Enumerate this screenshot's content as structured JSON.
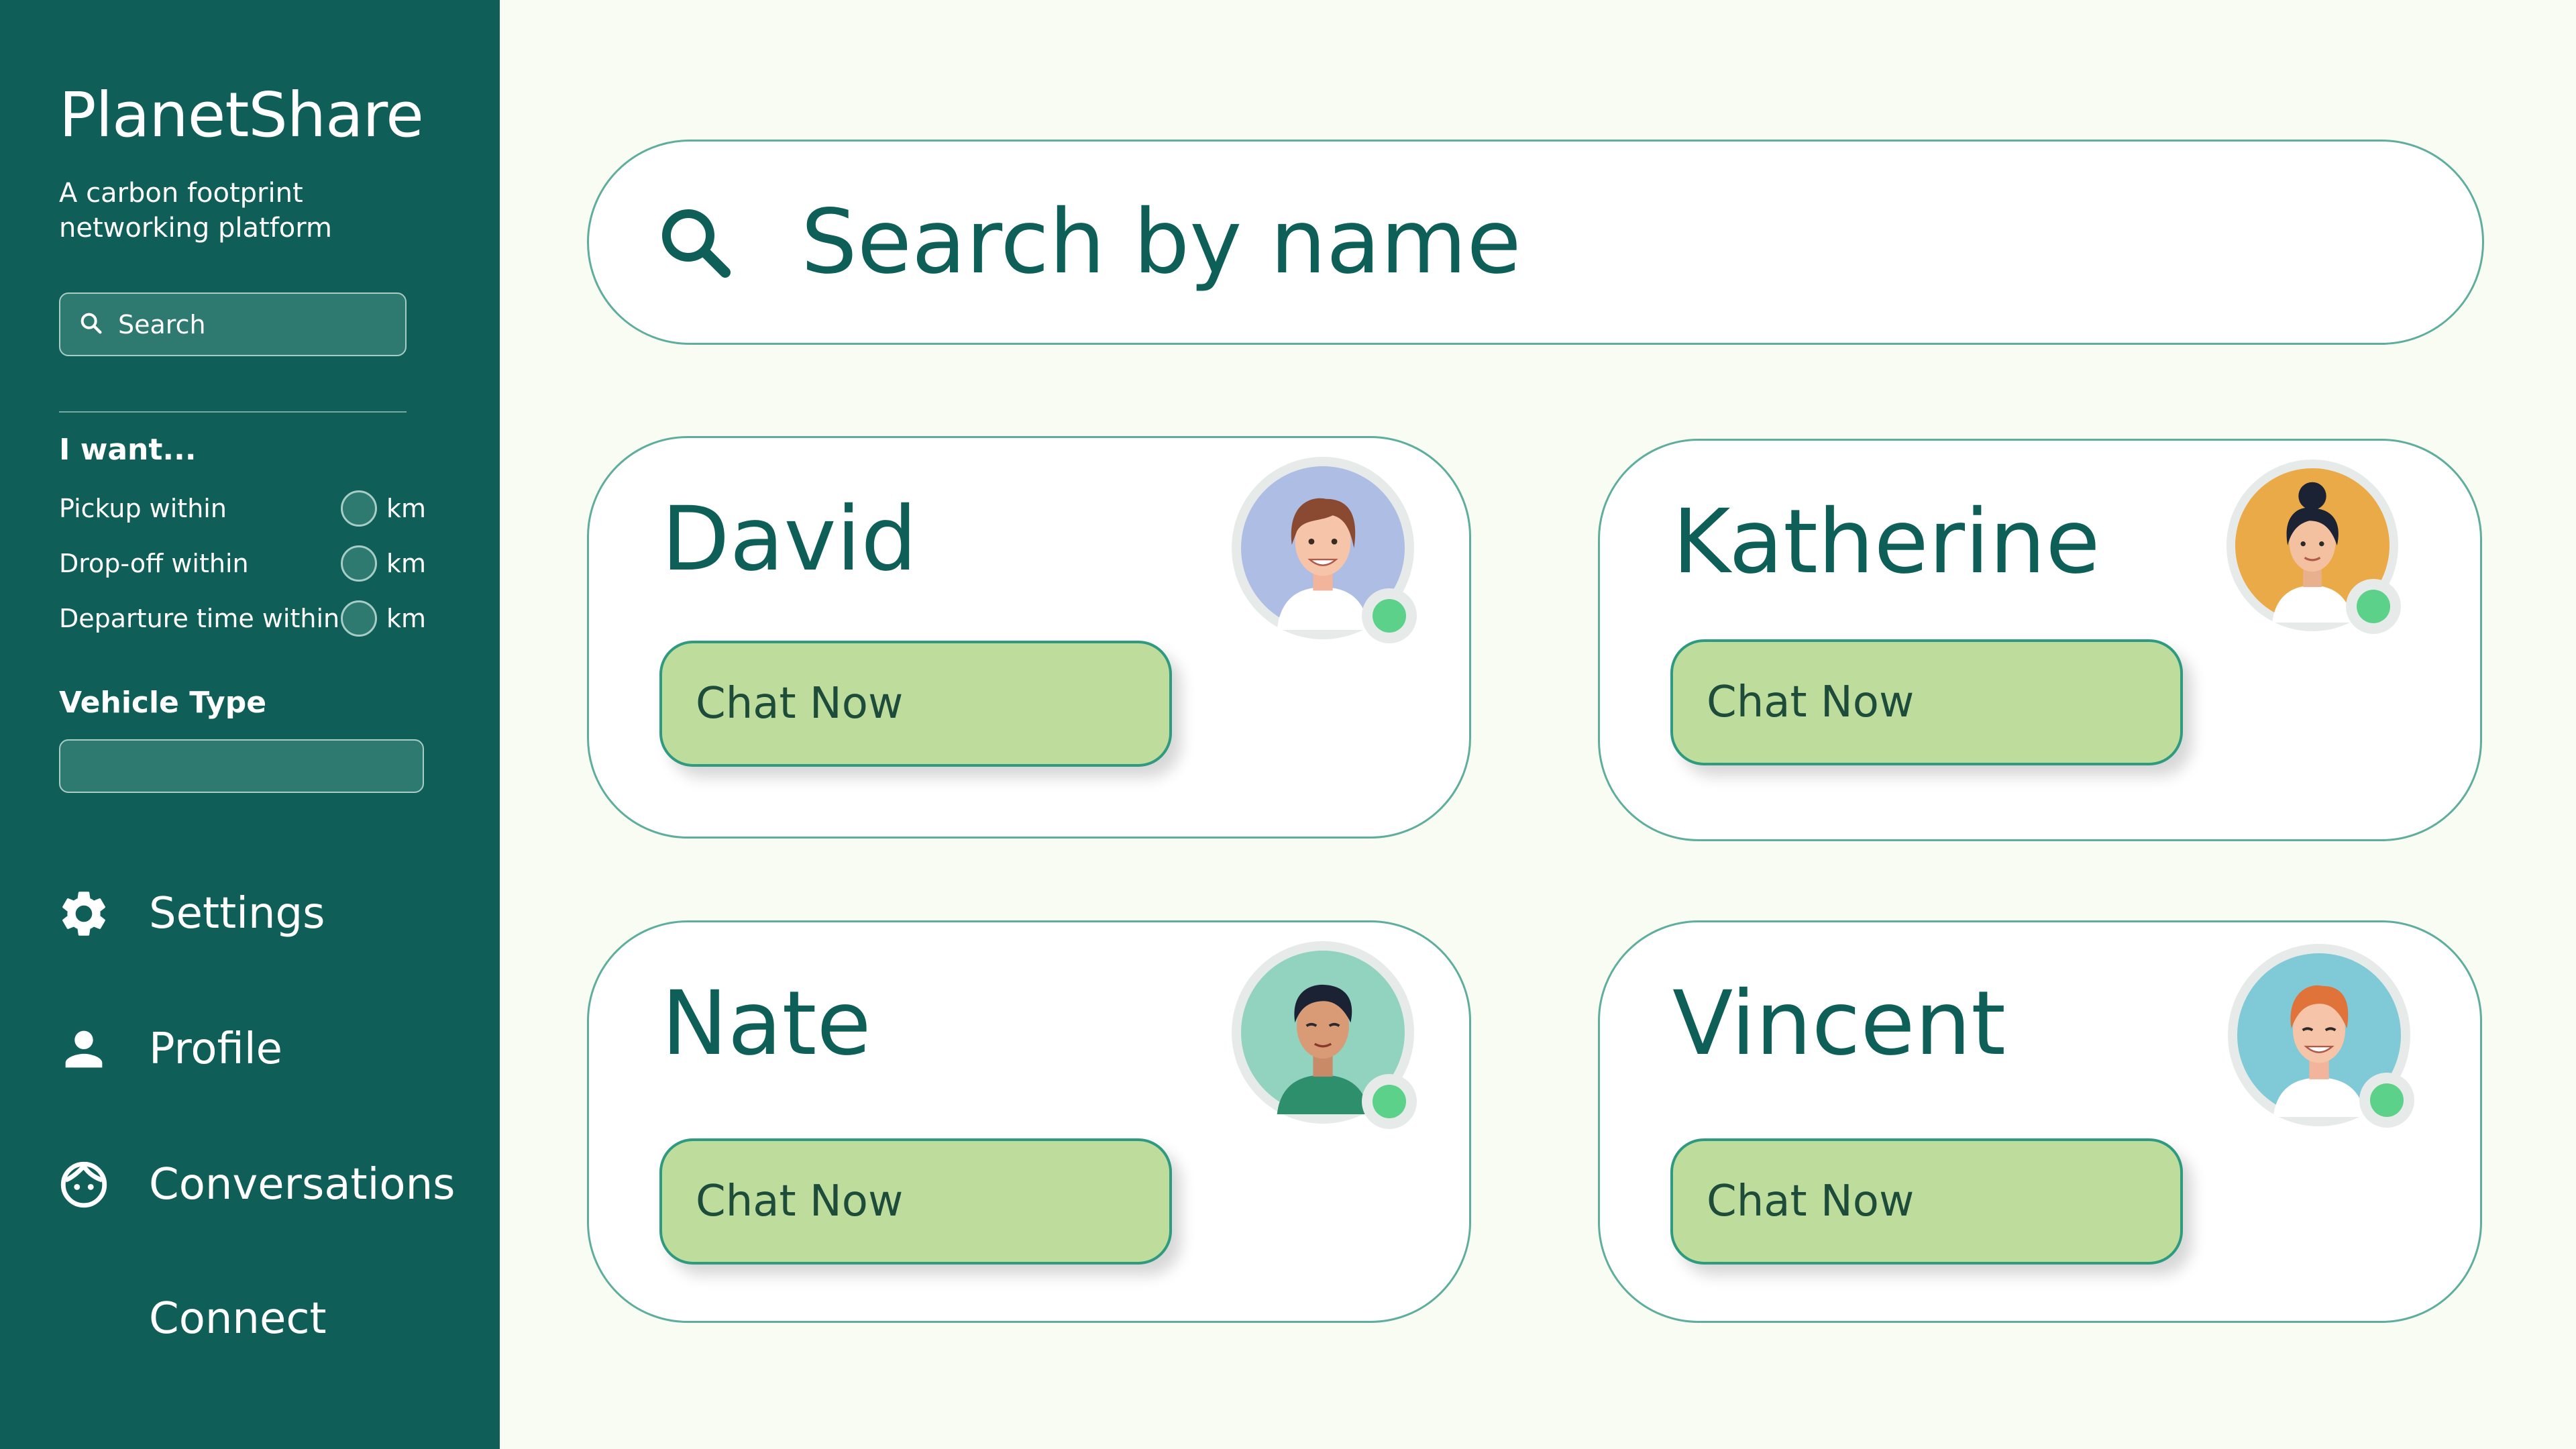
{
  "app": {
    "title": "PlanetShare",
    "subtitle": "A carbon footprint networking platform"
  },
  "sidebar": {
    "search_label": "Search",
    "want_heading": "I want...",
    "filters": [
      {
        "label": "Pickup within",
        "unit": "km"
      },
      {
        "label": "Drop-off within",
        "unit": "km"
      },
      {
        "label": "Departure time within",
        "unit": "km"
      }
    ],
    "vehicle_heading": "Vehicle Type",
    "vehicle_value": "",
    "nav": [
      {
        "label": "Settings",
        "icon": "gear-icon"
      },
      {
        "label": "Profile",
        "icon": "person-icon"
      },
      {
        "label": "Conversations",
        "icon": "face-icon"
      },
      {
        "label": "Connect",
        "icon": ""
      }
    ]
  },
  "main": {
    "search_placeholder": "Search by name",
    "people": [
      {
        "name": "David",
        "button": "Chat Now",
        "online": true,
        "avatar_bg": "#aebde3"
      },
      {
        "name": "Katherine",
        "button": "Chat Now",
        "online": true,
        "avatar_bg": "#eaaa48"
      },
      {
        "name": "Nate",
        "button": "Chat Now",
        "online": true,
        "avatar_bg": "#92d3c0"
      },
      {
        "name": "Vincent",
        "button": "Chat Now",
        "online": true,
        "avatar_bg": "#7fcad6"
      }
    ]
  },
  "colors": {
    "sidebar_bg": "#0f5f58",
    "page_bg": "#f8fcf2",
    "accent_text": "#0d5f57",
    "button_bg": "#bedd9c",
    "online": "#5cd18a"
  }
}
